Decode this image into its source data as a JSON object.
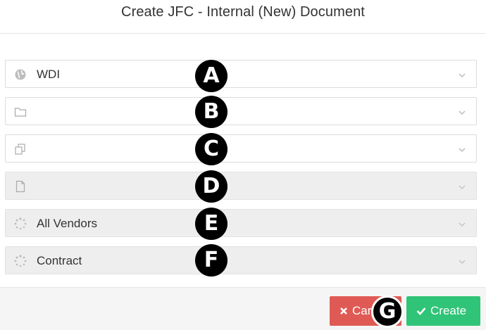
{
  "dialog": {
    "title": "Create JFC - Internal (New) Document"
  },
  "fields": [
    {
      "value": "WDI",
      "icon": "globe-icon",
      "disabled": false,
      "marker": "A"
    },
    {
      "value": "",
      "icon": "folder-icon",
      "disabled": false,
      "marker": "B"
    },
    {
      "value": "",
      "icon": "copy-icon",
      "disabled": false,
      "marker": "C"
    },
    {
      "value": "",
      "icon": "file-icon",
      "disabled": true,
      "marker": "D"
    },
    {
      "value": "All Vendors",
      "icon": "spinner-icon",
      "disabled": true,
      "marker": "E"
    },
    {
      "value": "Contract",
      "icon": "spinner-icon",
      "disabled": true,
      "marker": "F"
    }
  ],
  "footer": {
    "cancel_label": "Car",
    "create_label": "Create",
    "marker": "G"
  },
  "colors": {
    "cancel": "#e05a55",
    "create": "#2fc477",
    "marker": "#000000"
  }
}
